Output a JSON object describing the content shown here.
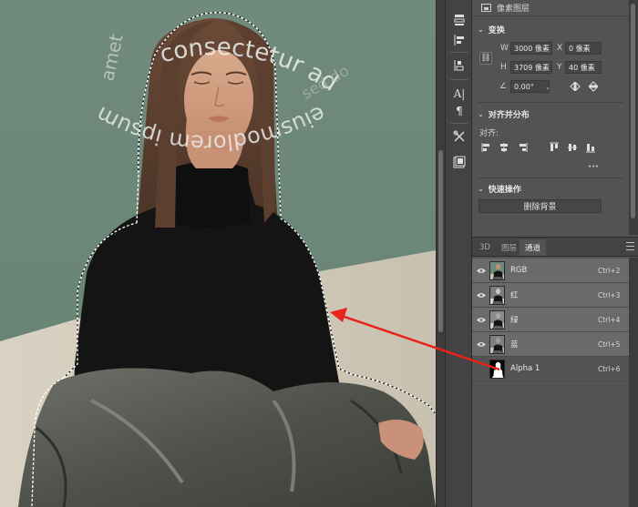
{
  "photo": {
    "text_top": "consectetur adipisic",
    "text_left": "amet",
    "text_bottom": "eiusmodlorem ipsum",
    "text_inner": "sed do"
  },
  "properties": {
    "header_title": "像素图层",
    "transform": {
      "title": "变换",
      "w_label": "W",
      "w_value": "3000 像素",
      "x_label": "X",
      "x_value": "0 像素",
      "h_label": "H",
      "h_value": "3709 像素",
      "y_label": "Y",
      "y_value": "40 像素",
      "angle_value": "0.00°"
    },
    "align": {
      "title": "对齐并分布",
      "label": "对齐:",
      "more": "···"
    },
    "quick": {
      "title": "快速操作",
      "remove_bg_label": "删除背景"
    }
  },
  "tabs": [
    {
      "label": "3D",
      "active": false
    },
    {
      "label": "图层",
      "active": false
    },
    {
      "label": "通道",
      "active": true
    }
  ],
  "channels": [
    {
      "name": "RGB",
      "shortcut": "Ctrl+2",
      "selected": true,
      "visible": true
    },
    {
      "name": "红",
      "shortcut": "Ctrl+3",
      "selected": true,
      "visible": true
    },
    {
      "name": "绿",
      "shortcut": "Ctrl+4",
      "selected": true,
      "visible": true
    },
    {
      "name": "蓝",
      "shortcut": "Ctrl+5",
      "selected": true,
      "visible": true
    },
    {
      "name": "Alpha 1",
      "shortcut": "Ctrl+6",
      "selected": false,
      "visible": false
    }
  ],
  "colors": {
    "panel_bg": "#535353",
    "selected_row": "#6a6a6a",
    "arrow": "#e8231c",
    "photo_bg": "#6f8c7c"
  },
  "icons": {
    "tools": [
      "arrange-icon",
      "align-icon",
      "distribute-icon",
      "puppet-icon",
      "character-icon",
      "paragraph-icon",
      "tools-icon",
      "channels-icon"
    ]
  }
}
